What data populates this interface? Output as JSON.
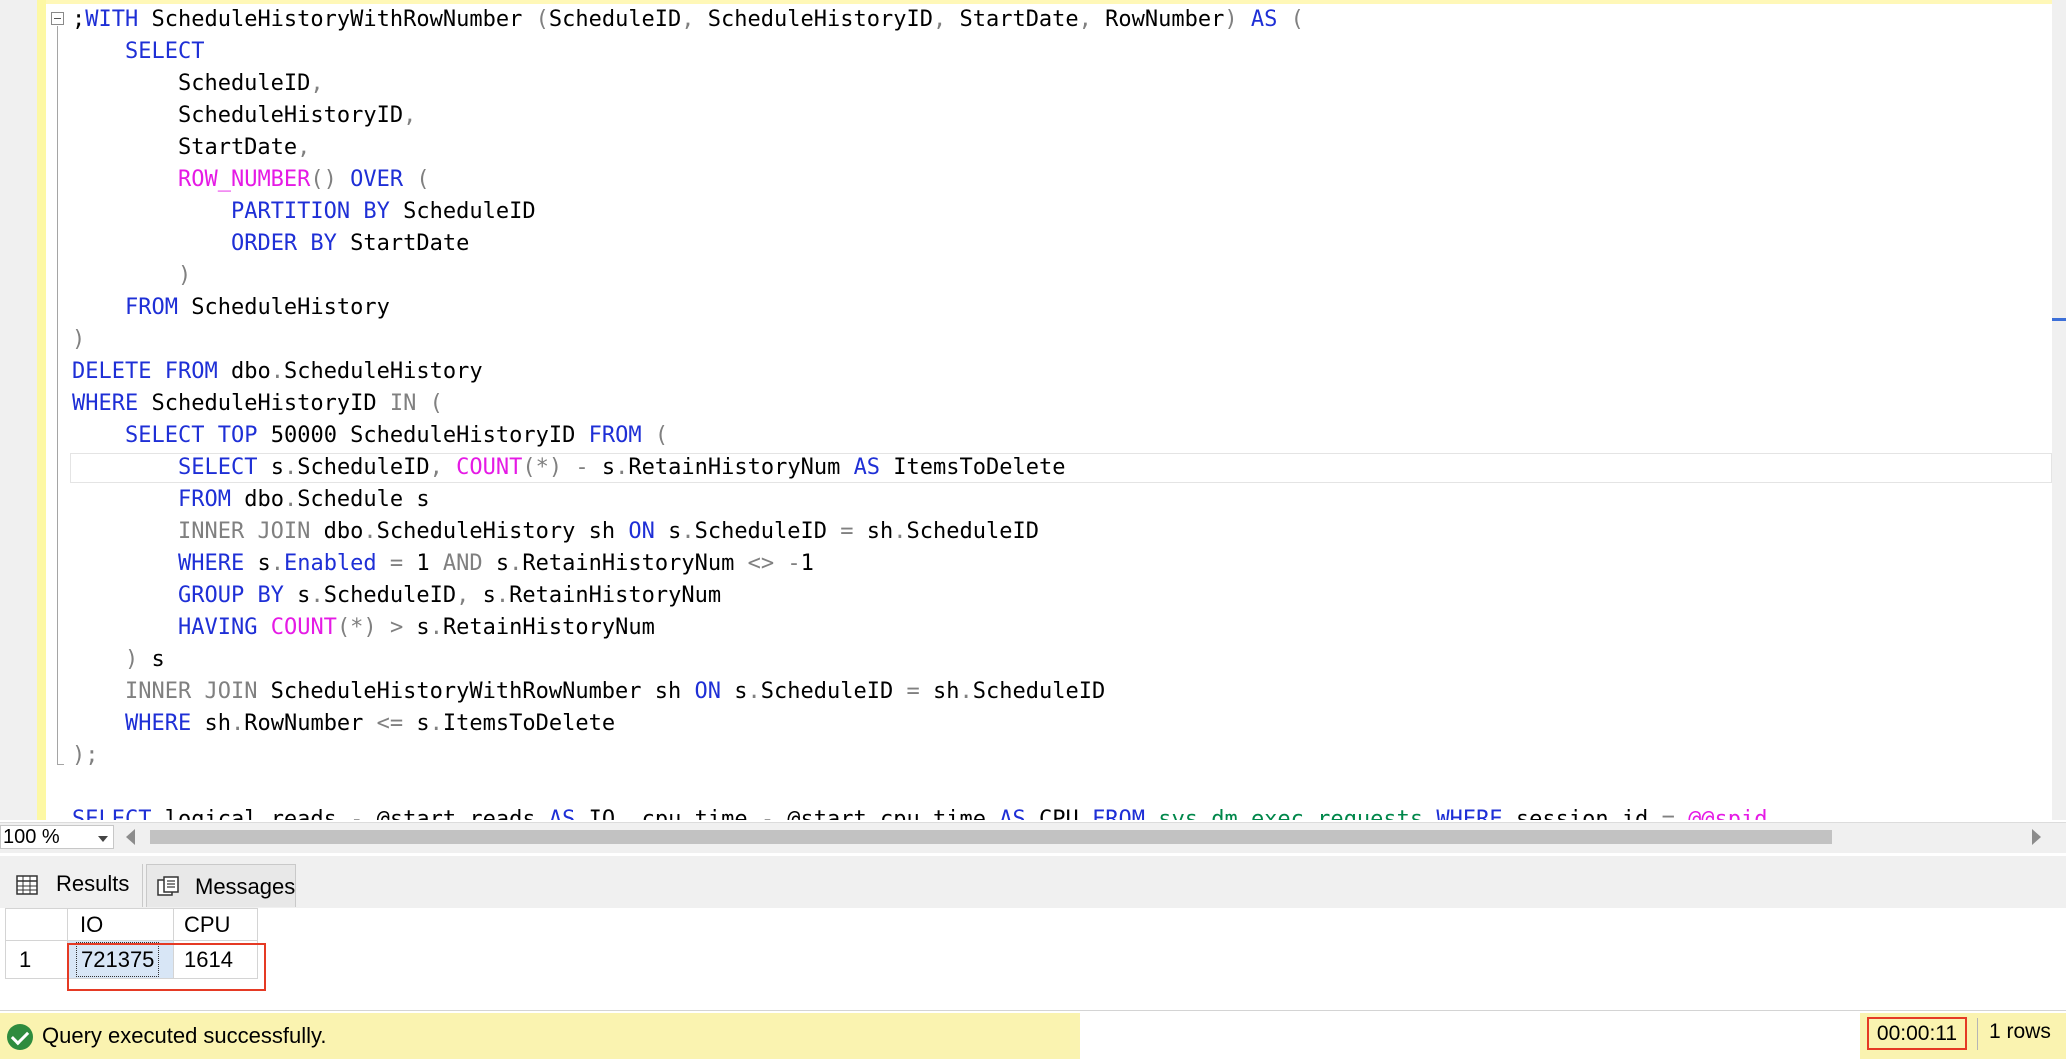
{
  "editor": {
    "code_lines": [
      [
        [
          ";",
          ""
        ],
        [
          "WITH",
          "kw"
        ],
        [
          " ScheduleHistoryWithRowNumber ",
          ""
        ],
        [
          "(",
          "gr"
        ],
        [
          "ScheduleID",
          ""
        ],
        [
          ",",
          "gr"
        ],
        [
          " ScheduleHistoryID",
          ""
        ],
        [
          ",",
          "gr"
        ],
        [
          " StartDate",
          ""
        ],
        [
          ",",
          "gr"
        ],
        [
          " RowNumber",
          ""
        ],
        [
          ")",
          "gr"
        ],
        [
          " ",
          ""
        ],
        [
          "AS",
          "kw"
        ],
        [
          " ",
          ""
        ],
        [
          "(",
          "gr"
        ]
      ],
      [
        [
          "    ",
          ""
        ],
        [
          "SELECT",
          "kw"
        ]
      ],
      [
        [
          "        ScheduleID",
          ""
        ],
        [
          ",",
          "gr"
        ]
      ],
      [
        [
          "        ScheduleHistoryID",
          ""
        ],
        [
          ",",
          "gr"
        ]
      ],
      [
        [
          "        StartDate",
          ""
        ],
        [
          ",",
          "gr"
        ]
      ],
      [
        [
          "        ",
          ""
        ],
        [
          "ROW_NUMBER",
          "fn"
        ],
        [
          "()",
          "gr"
        ],
        [
          " ",
          ""
        ],
        [
          "OVER",
          "kw"
        ],
        [
          " ",
          ""
        ],
        [
          "(",
          "gr"
        ]
      ],
      [
        [
          "            ",
          ""
        ],
        [
          "PARTITION BY",
          "kw"
        ],
        [
          " ScheduleID",
          ""
        ]
      ],
      [
        [
          "            ",
          ""
        ],
        [
          "ORDER BY",
          "kw"
        ],
        [
          " StartDate",
          ""
        ]
      ],
      [
        [
          "        ",
          ""
        ],
        [
          ")",
          "gr"
        ]
      ],
      [
        [
          "    ",
          ""
        ],
        [
          "FROM",
          "kw"
        ],
        [
          " ScheduleHistory",
          ""
        ]
      ],
      [
        [
          ")",
          "gr"
        ]
      ],
      [
        [
          "DELETE",
          "kw"
        ],
        [
          " ",
          ""
        ],
        [
          "FROM",
          "kw"
        ],
        [
          " dbo",
          ""
        ],
        [
          ".",
          "gr"
        ],
        [
          "ScheduleHistory",
          ""
        ]
      ],
      [
        [
          "WHERE",
          "kw"
        ],
        [
          " ScheduleHistoryID ",
          ""
        ],
        [
          "IN",
          "gr"
        ],
        [
          " ",
          ""
        ],
        [
          "(",
          "gr"
        ]
      ],
      [
        [
          "    ",
          ""
        ],
        [
          "SELECT",
          "kw"
        ],
        [
          " ",
          ""
        ],
        [
          "TOP",
          "kw"
        ],
        [
          " 50000 ScheduleHistoryID ",
          ""
        ],
        [
          "FROM",
          "kw"
        ],
        [
          " ",
          ""
        ],
        [
          "(",
          "gr"
        ]
      ],
      [
        [
          "        ",
          ""
        ],
        [
          "SELECT",
          "kw"
        ],
        [
          " s",
          ""
        ],
        [
          ".",
          "gr"
        ],
        [
          "ScheduleID",
          ""
        ],
        [
          ",",
          "gr"
        ],
        [
          " ",
          ""
        ],
        [
          "COUNT",
          "fn"
        ],
        [
          "(*)",
          "gr"
        ],
        [
          " ",
          ""
        ],
        [
          "-",
          "gr"
        ],
        [
          " s",
          ""
        ],
        [
          ".",
          "gr"
        ],
        [
          "RetainHistoryNum ",
          ""
        ],
        [
          "AS",
          "kw"
        ],
        [
          " ItemsToDelete",
          ""
        ]
      ],
      [
        [
          "        ",
          ""
        ],
        [
          "FROM",
          "kw"
        ],
        [
          " dbo",
          ""
        ],
        [
          ".",
          "gr"
        ],
        [
          "Schedule s",
          ""
        ]
      ],
      [
        [
          "        ",
          ""
        ],
        [
          "INNER JOIN",
          "gr"
        ],
        [
          " dbo",
          ""
        ],
        [
          ".",
          "gr"
        ],
        [
          "ScheduleHistory sh ",
          ""
        ],
        [
          "ON",
          "kw"
        ],
        [
          " s",
          ""
        ],
        [
          ".",
          "gr"
        ],
        [
          "ScheduleID ",
          ""
        ],
        [
          "=",
          "gr"
        ],
        [
          " sh",
          ""
        ],
        [
          ".",
          "gr"
        ],
        [
          "ScheduleID",
          ""
        ]
      ],
      [
        [
          "        ",
          ""
        ],
        [
          "WHERE",
          "kw"
        ],
        [
          " s",
          ""
        ],
        [
          ".",
          "gr"
        ],
        [
          "Enabled",
          "kw"
        ],
        [
          " ",
          ""
        ],
        [
          "=",
          "gr"
        ],
        [
          " 1 ",
          ""
        ],
        [
          "AND",
          "gr"
        ],
        [
          " s",
          ""
        ],
        [
          ".",
          "gr"
        ],
        [
          "RetainHistoryNum ",
          ""
        ],
        [
          "<>",
          "gr"
        ],
        [
          " ",
          ""
        ],
        [
          "-",
          "gr"
        ],
        [
          "1",
          ""
        ]
      ],
      [
        [
          "        ",
          ""
        ],
        [
          "GROUP BY",
          "kw"
        ],
        [
          " s",
          ""
        ],
        [
          ".",
          "gr"
        ],
        [
          "ScheduleID",
          ""
        ],
        [
          ",",
          "gr"
        ],
        [
          " s",
          ""
        ],
        [
          ".",
          "gr"
        ],
        [
          "RetainHistoryNum",
          ""
        ]
      ],
      [
        [
          "        ",
          ""
        ],
        [
          "HAVING",
          "kw"
        ],
        [
          " ",
          ""
        ],
        [
          "COUNT",
          "fn"
        ],
        [
          "(*)",
          "gr"
        ],
        [
          " ",
          ""
        ],
        [
          ">",
          "gr"
        ],
        [
          " s",
          ""
        ],
        [
          ".",
          "gr"
        ],
        [
          "RetainHistoryNum",
          ""
        ]
      ],
      [
        [
          "    ",
          ""
        ],
        [
          ")",
          "gr"
        ],
        [
          " s",
          ""
        ]
      ],
      [
        [
          "    ",
          ""
        ],
        [
          "INNER JOIN",
          "gr"
        ],
        [
          " ScheduleHistoryWithRowNumber sh ",
          ""
        ],
        [
          "ON",
          "kw"
        ],
        [
          " s",
          ""
        ],
        [
          ".",
          "gr"
        ],
        [
          "ScheduleID ",
          ""
        ],
        [
          "=",
          "gr"
        ],
        [
          " sh",
          ""
        ],
        [
          ".",
          "gr"
        ],
        [
          "ScheduleID",
          ""
        ]
      ],
      [
        [
          "    ",
          ""
        ],
        [
          "WHERE",
          "kw"
        ],
        [
          " sh",
          ""
        ],
        [
          ".",
          "gr"
        ],
        [
          "RowNumber ",
          ""
        ],
        [
          "<=",
          "gr"
        ],
        [
          " s",
          ""
        ],
        [
          ".",
          "gr"
        ],
        [
          "ItemsToDelete",
          ""
        ]
      ],
      [
        [
          ");",
          "gr"
        ]
      ],
      [
        [
          "",
          ""
        ]
      ],
      [
        [
          "SELECT",
          "kw"
        ],
        [
          " logical_reads ",
          ""
        ],
        [
          "-",
          "gr"
        ],
        [
          " @start_reads ",
          ""
        ],
        [
          "AS",
          "kw"
        ],
        [
          " ",
          ""
        ],
        [
          "IO",
          ""
        ],
        [
          ",",
          "gr"
        ],
        [
          " cpu_time ",
          ""
        ],
        [
          "-",
          "gr"
        ],
        [
          " @start_cpu_time ",
          ""
        ],
        [
          "AS",
          "kw"
        ],
        [
          " CPU ",
          ""
        ],
        [
          "FROM",
          "kw"
        ],
        [
          " ",
          ""
        ],
        [
          "sys",
          "gn"
        ],
        [
          ".",
          "gr"
        ],
        [
          "dm_exec_requests",
          "gn"
        ],
        [
          " ",
          ""
        ],
        [
          "WHERE",
          "kw"
        ],
        [
          " session_id ",
          ""
        ],
        [
          "=",
          "gr"
        ],
        [
          " ",
          ""
        ],
        [
          "@@spid",
          "fn"
        ]
      ]
    ]
  },
  "zoom": {
    "value": "100 %"
  },
  "tabs": {
    "results": "Results",
    "messages": "Messages"
  },
  "grid": {
    "columns": [
      "IO",
      "CPU"
    ],
    "rows": [
      {
        "num": "1",
        "io": "721375",
        "cpu": "1614"
      }
    ]
  },
  "status": {
    "message": "Query executed successfully.",
    "elapsed": "00:00:11",
    "rows": "1 rows"
  },
  "colors": {
    "keyword": "#1e2fd6",
    "function": "#e51ae5",
    "operator": "#808080",
    "system_object": "#00874a",
    "highlight_box": "#e53a24",
    "status_bar": "#faf3b0"
  }
}
